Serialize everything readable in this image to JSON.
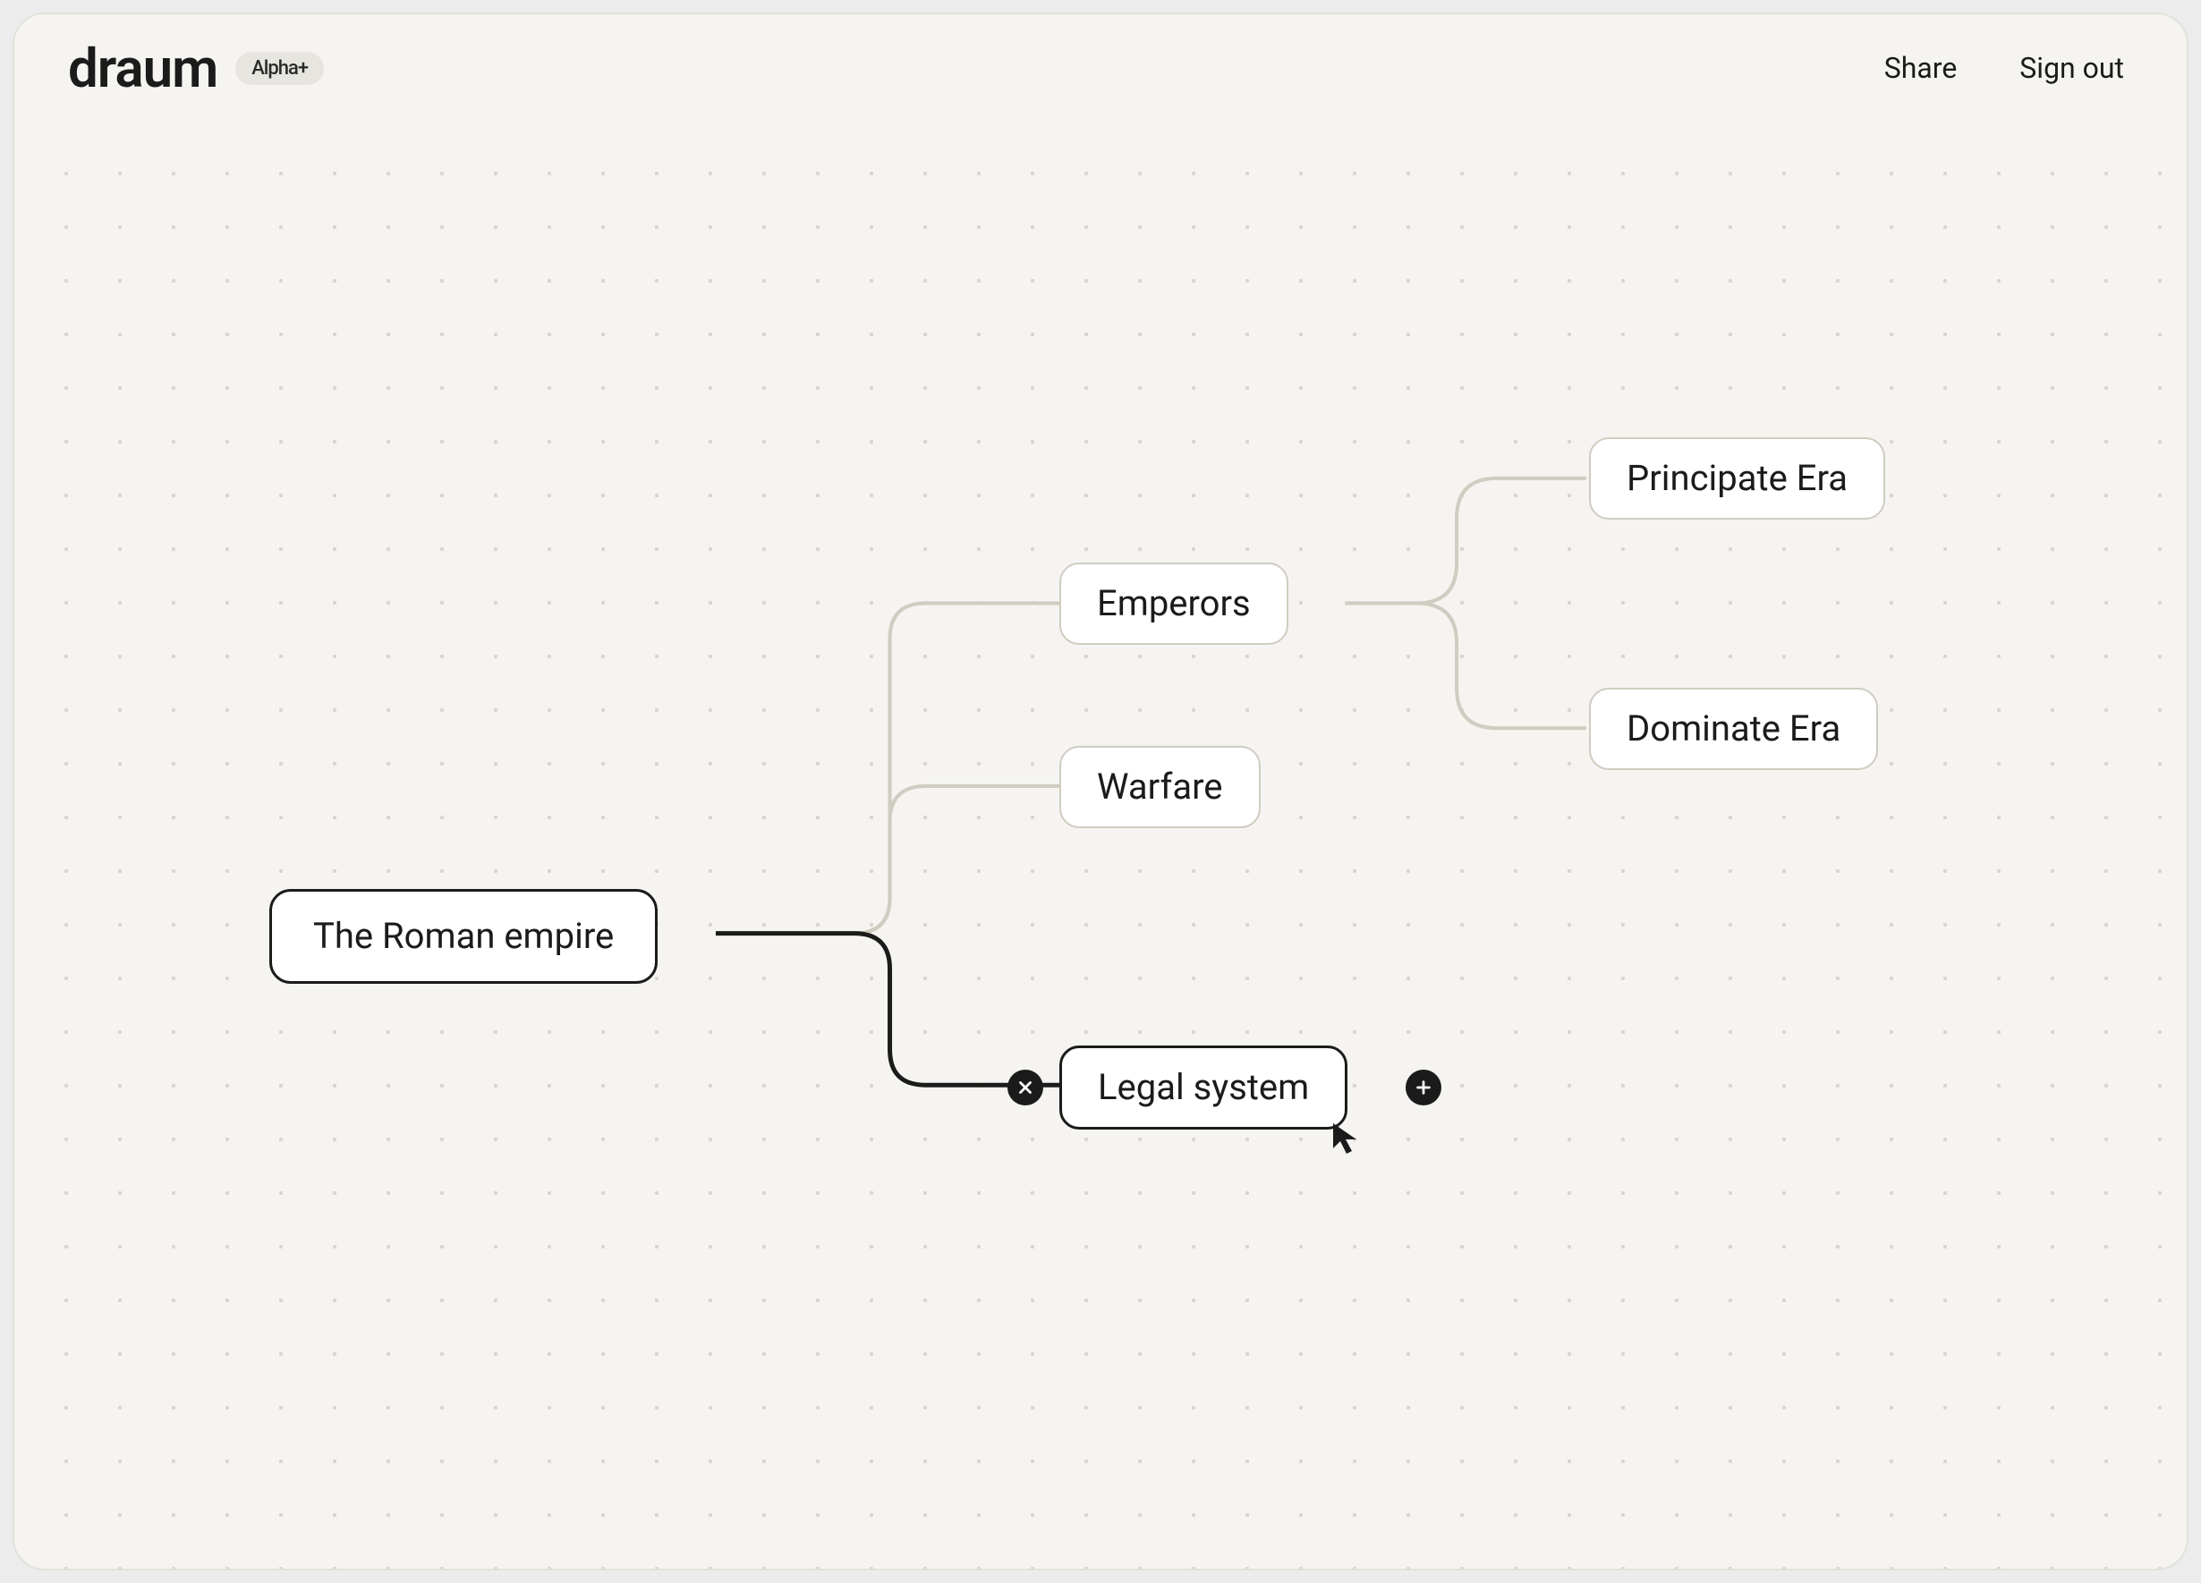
{
  "header": {
    "brand": "draum",
    "badge": "Alpha+",
    "share_label": "Share",
    "signout_label": "Sign out"
  },
  "nodes": {
    "root": "The Roman empire",
    "emperors": "Emperors",
    "warfare": "Warfare",
    "legal": "Legal system",
    "principate": "Principate Era",
    "dominate": "Dominate Era"
  },
  "icons": {
    "delete": "close-icon",
    "add": "plus-icon",
    "cursor": "cursor-icon"
  }
}
